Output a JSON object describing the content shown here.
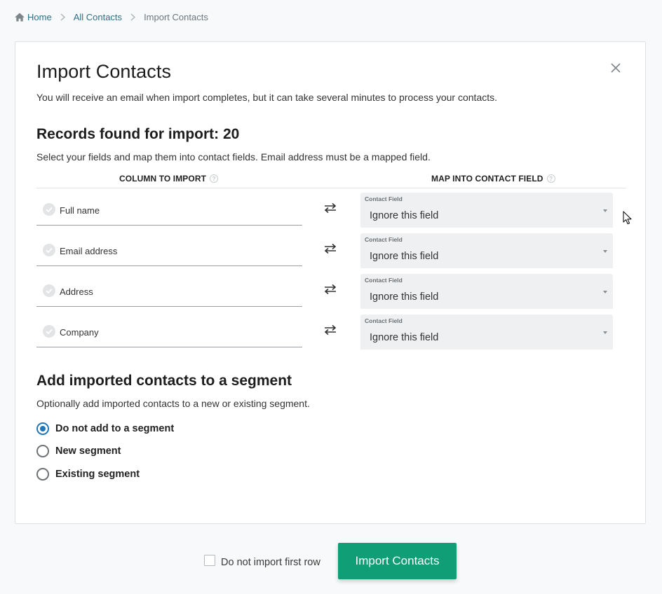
{
  "breadcrumb": {
    "home": "Home",
    "all_contacts": "All Contacts",
    "current": "Import Contacts"
  },
  "modal": {
    "title": "Import Contacts",
    "subtitle": "You will receive an email when import completes, but it can take several minutes to process your contacts.",
    "records_title": "Records found for import: 20",
    "records_desc": "Select your fields and map them into contact fields. Email address must be a mapped field.",
    "col_left": "COLUMN TO IMPORT",
    "col_right": "MAP INTO CONTACT FIELD",
    "help_glyph": "?",
    "rows": [
      {
        "source": "Full name",
        "caption": "Contact Field",
        "value": "Ignore this field"
      },
      {
        "source": "Email address",
        "caption": "Contact Field",
        "value": "Ignore this field"
      },
      {
        "source": "Address",
        "caption": "Contact Field",
        "value": "Ignore this field"
      },
      {
        "source": "Company",
        "caption": "Contact Field",
        "value": "Ignore this field"
      }
    ],
    "segment_title": "Add imported contacts to a segment",
    "segment_desc": "Optionally add imported contacts to a new or existing segment.",
    "segment_options": [
      {
        "label": "Do not add to a segment",
        "checked": true
      },
      {
        "label": "New segment",
        "checked": false
      },
      {
        "label": "Existing segment",
        "checked": false
      }
    ]
  },
  "footer": {
    "checkbox_label": "Do not import first row",
    "checkbox_checked": false,
    "import_button": "Import Contacts"
  },
  "icons": {
    "home": "home-icon",
    "separator": "chevron-right-icon",
    "close": "close-icon",
    "check": "check-circle-icon",
    "swap": "swap-arrows-icon",
    "dropdown": "caret-down-icon",
    "help": "help-circle-icon",
    "cursor": "mouse-pointer-icon"
  },
  "colors": {
    "link": "#2e6f86",
    "primary_button": "#0f9e75",
    "radio_checked": "#1f76b9",
    "select_bg": "#eef0f2"
  }
}
